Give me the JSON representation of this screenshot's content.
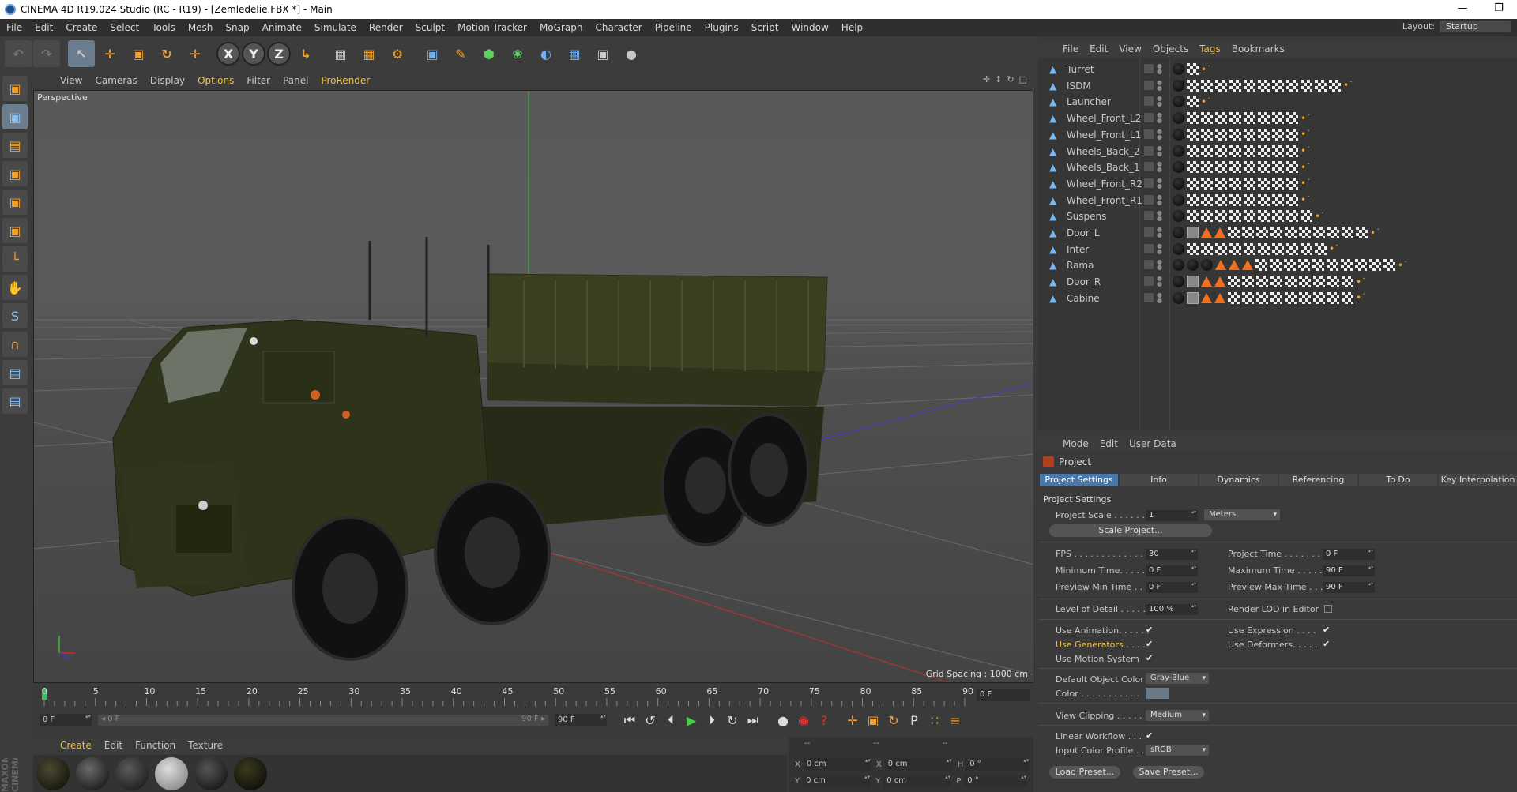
{
  "window": {
    "title": "CINEMA 4D R19.024 Studio (RC - R19) - [Zemledelie.FBX *] - Main",
    "minimize": "—",
    "restore": "❐"
  },
  "menu": [
    "File",
    "Edit",
    "Create",
    "Select",
    "Tools",
    "Mesh",
    "Snap",
    "Animate",
    "Simulate",
    "Render",
    "Sculpt",
    "Motion Tracker",
    "MoGraph",
    "Character",
    "Pipeline",
    "Plugins",
    "Script",
    "Window",
    "Help"
  ],
  "layout": {
    "label": "Layout:",
    "value": "Startup"
  },
  "toolbar": {
    "undo": "↶",
    "redo": "↷",
    "select": "↖",
    "move": "✛",
    "scale": "▣",
    "rotate": "↻",
    "add": "✛",
    "x": "X",
    "y": "Y",
    "z": "Z",
    "coord": "↳",
    "render_view": "▦",
    "render_pv": "▦",
    "render_settings": "⚙",
    "cube": "▣",
    "pen": "✎",
    "subdiv": "⬢",
    "cloner": "❀",
    "deformer": "◐",
    "floor": "▦",
    "camera": "▣",
    "light": "●"
  },
  "lefttools": [
    "▣",
    "▣",
    "▤",
    "▣",
    "▣",
    "▣",
    "└",
    "✋",
    "S",
    "∩",
    "▤",
    "▤"
  ],
  "viewport": {
    "menu": [
      "View",
      "Cameras",
      "Display",
      "Options",
      "Filter",
      "Panel",
      "ProRender"
    ],
    "nav": [
      "✛",
      "↕",
      "↻",
      "□"
    ],
    "label": "Perspective",
    "grid_spacing": "Grid Spacing : 1000 cm"
  },
  "timeline": {
    "ticks": [
      "0",
      "5",
      "10",
      "15",
      "20",
      "25",
      "30",
      "35",
      "40",
      "45",
      "50",
      "55",
      "60",
      "65",
      "70",
      "75",
      "80",
      "85",
      "90"
    ],
    "current_frame": "0 F"
  },
  "transport": {
    "start": "0 F",
    "slider_left": "◂ 0 F",
    "slider_right": "90 F ▸",
    "end": "90 F",
    "buttons": [
      "⏮",
      "↺",
      "⏴",
      "▶",
      "⏵",
      "↻",
      "⏭",
      "●",
      "◉",
      "?",
      "✛",
      "▣",
      "↻",
      "P",
      "∷",
      "≡"
    ]
  },
  "materials": {
    "menu": [
      "Create",
      "Edit",
      "Function",
      "Texture"
    ],
    "side_label": "MAXON CINEMA 4D"
  },
  "coords": {
    "header": [
      "--",
      "--",
      "--"
    ],
    "rows": [
      {
        "a": "X",
        "av": "0 cm",
        "b": "X",
        "bv": "0 cm",
        "c": "H",
        "cv": "0 °"
      },
      {
        "a": "Y",
        "av": "0 cm",
        "b": "Y",
        "bv": "0 cm",
        "c": "P",
        "cv": "0 °"
      }
    ]
  },
  "objmgr": {
    "menu": [
      "File",
      "Edit",
      "View",
      "Objects",
      "Tags",
      "Bookmarks"
    ],
    "objects": [
      {
        "name": "Turret",
        "tags": "bce"
      },
      {
        "name": "ISDM",
        "tags": "bccccccccccce"
      },
      {
        "name": "Launcher",
        "tags": "bce"
      },
      {
        "name": "Wheel_Front_L2",
        "tags": "bcccccccce"
      },
      {
        "name": "Wheel_Front_L1",
        "tags": "bcccccccce"
      },
      {
        "name": "Wheels_Back_2",
        "tags": "bcccccccce"
      },
      {
        "name": "Wheels_Back_1",
        "tags": "bcccccccce"
      },
      {
        "name": "Wheel_Front_R2",
        "tags": "bcccccccce"
      },
      {
        "name": "Wheel_Front_R1",
        "tags": "bcccccccce"
      },
      {
        "name": "Suspens",
        "tags": "bccccccccce"
      },
      {
        "name": "Door_L",
        "tags": "bpttcccccccccce"
      },
      {
        "name": "Inter",
        "tags": "bcccccccccce"
      },
      {
        "name": "Rama",
        "tags": "bbbtttcccccccccce"
      },
      {
        "name": "Door_R",
        "tags": "bpttccccccccce"
      },
      {
        "name": "Cabine",
        "tags": "bpttccccccccce"
      }
    ]
  },
  "attr": {
    "menu": [
      "Mode",
      "Edit",
      "User Data"
    ],
    "heading": "Project",
    "tabs": [
      "Project Settings",
      "Info",
      "Dynamics",
      "Referencing",
      "To Do",
      "Key Interpolation"
    ],
    "section": "Project Settings",
    "project_scale_label": "Project Scale . . . . . .",
    "project_scale": "1",
    "unit": "Meters",
    "scale_button": "Scale Project...",
    "fps_label": "FPS . . . . . . . . . . . . . .",
    "fps": "30",
    "project_time_label": "Project Time . . . . . . . .",
    "project_time": "0 F",
    "min_time_label": "Minimum Time. . . . . .",
    "min_time": "0 F",
    "max_time_label": "Maximum Time . . . . .",
    "max_time": "90 F",
    "prev_min_label": "Preview Min Time . . .",
    "prev_min": "0 F",
    "prev_max_label": "Preview Max Time . . .",
    "prev_max": "90 F",
    "lod_label": "Level of Detail . . . . .",
    "lod": "100 %",
    "render_lod_label": "Render LOD in Editor",
    "use_anim_label": "Use Animation. . . . . .",
    "use_expr_label": "Use Expression . . . .",
    "use_gen_label": "Use Generators . . . .",
    "use_def_label": "Use Deformers. . . . .",
    "use_motion_label": "Use Motion System",
    "check": "✔",
    "default_color_label": "Default Object Color",
    "default_color": "Gray-Blue",
    "color_label": "Color . . . . . . . . . . .",
    "view_clip_label": "View Clipping . . . . . .",
    "view_clip": "Medium",
    "linear_label": "Linear Workflow . . . .",
    "input_profile_label": "Input Color Profile . .",
    "input_profile": "sRGB",
    "load_preset": "Load Preset...",
    "save_preset": "Save Preset..."
  }
}
